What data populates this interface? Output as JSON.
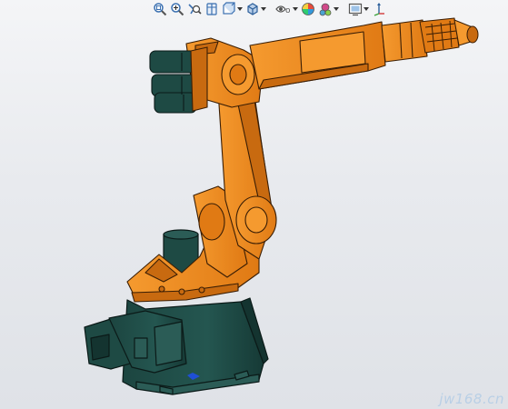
{
  "toolbar": {
    "items": [
      {
        "icon": "zoom-to-fit-icon"
      },
      {
        "icon": "zoom-to-area-icon"
      },
      {
        "icon": "previous-view-icon"
      },
      {
        "icon": "section-view-icon"
      },
      {
        "icon": "view-orientation-icon",
        "dropdown": true
      },
      {
        "icon": "display-style-icon",
        "dropdown": true
      },
      {
        "icon": "hide-show-items-icon",
        "dropdown": true
      },
      {
        "icon": "edit-appearance-icon",
        "dropdown": true
      },
      {
        "icon": "apply-scene-icon",
        "dropdown": true
      },
      {
        "icon": "view-settings-icon",
        "dropdown": true
      },
      {
        "icon": "coordinate-axes-icon"
      }
    ]
  },
  "model": {
    "name": "industrial-robot-arm",
    "colors": {
      "arm": "#f0891f",
      "arm_shade": "#c86a10",
      "outline": "#3a1e05",
      "base": "#1e4a44",
      "base_shade": "#143430",
      "background_top": "#f4f5f7",
      "background_bottom": "#dfe2e7"
    }
  },
  "watermark": {
    "text": "jw168.cn"
  }
}
